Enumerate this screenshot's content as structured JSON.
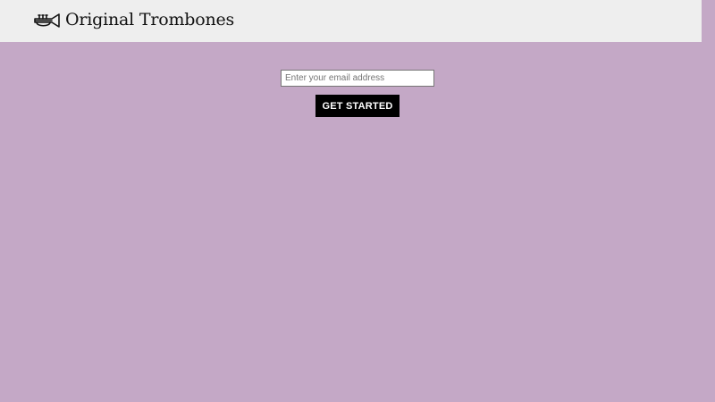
{
  "header": {
    "brand_name": "Original Trombones",
    "logo_icon": "trumpet-icon"
  },
  "signup_form": {
    "email_placeholder": "Enter your email address",
    "email_value": "",
    "submit_label": "GET STARTED"
  },
  "colors": {
    "page_background": "#c4a8c6",
    "header_background": "#eeeeee",
    "button_background": "#000000",
    "button_text": "#ffffff"
  }
}
